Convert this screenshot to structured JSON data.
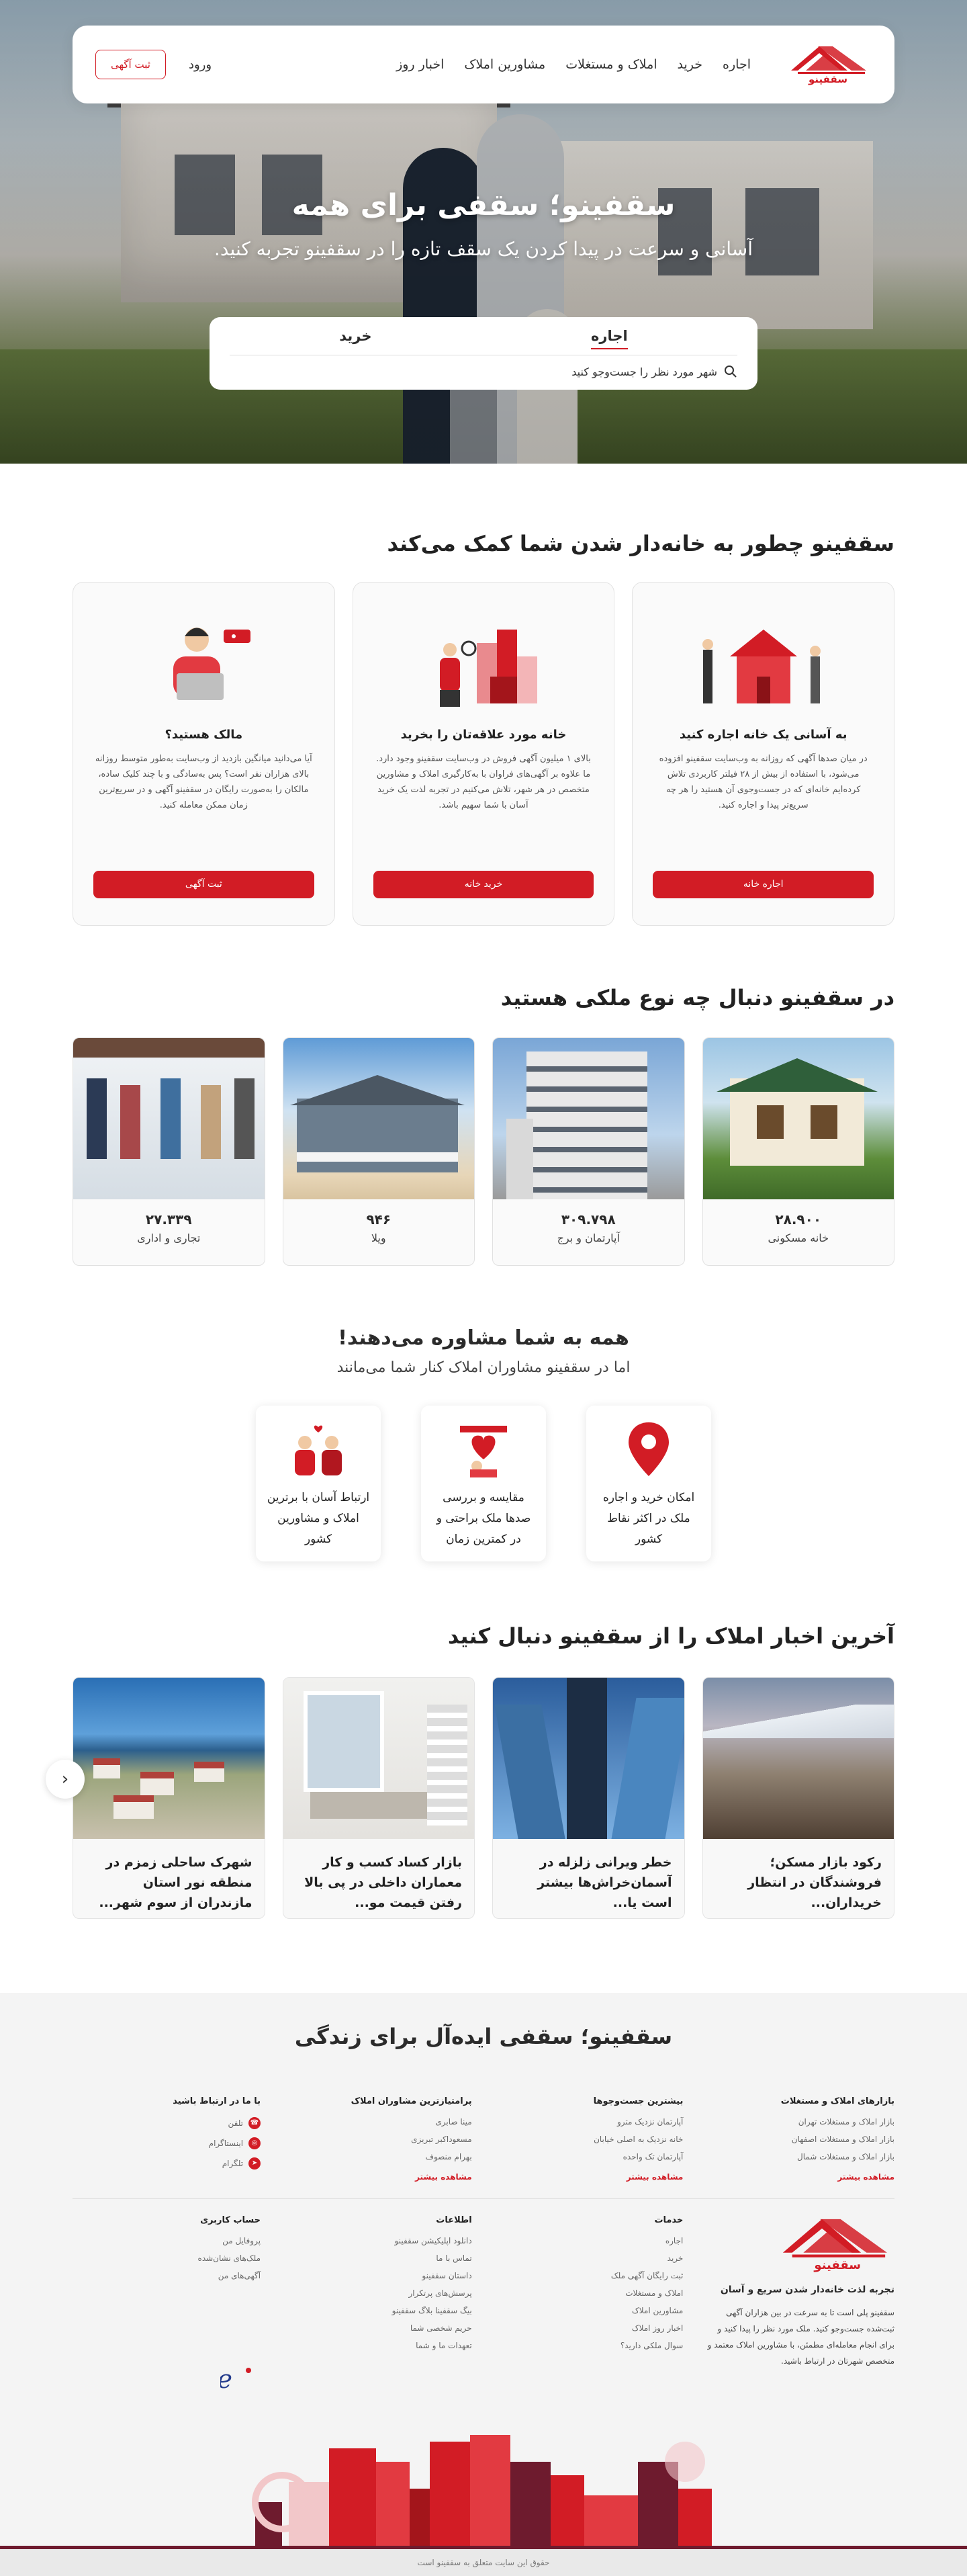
{
  "brand": {
    "name": "سقفینو",
    "accent": "#d21c25"
  },
  "nav": {
    "links": [
      "اجاره",
      "خرید",
      "املاک و مستغلات",
      "مشاورین املاک",
      "اخبار روز"
    ],
    "login": "ورود",
    "post_ad": "ثبت آگهی"
  },
  "hero": {
    "title": "سقفینو؛ سقفی برای همه",
    "subtitle": "آسانی و سرعت در پیدا کردن یک سقف تازه را در سقفینو تجربه کنید.",
    "tabs": [
      "اجاره",
      "خرید"
    ],
    "search_placeholder": "شهر مورد نظر را جست‌وجو کنید"
  },
  "help": {
    "title": "سقفینو چطور به خانه‌دار شدن شما کمک می‌کند",
    "cards": [
      {
        "title": "به آسانی یک خانه اجاره کنید",
        "text": "در میان صدها آگهی که روزانه به وب‌سایت سقفینو افزوده می‌شود، با استفاده از بیش از ۲۸ فیلتر کاربردی تلاش کرده‌ایم خانه‌ای که در جست‌وجوی آن هستید را هر چه سریع‌تر پیدا و اجاره کنید.",
        "button": "اجاره خانه"
      },
      {
        "title": "خانه مورد علاقه‌تان را بخرید",
        "text": "بالای ۱ میلیون آگهی فروش در وب‌سایت سقفینو وجود دارد. ما علاوه بر آگهی‌های فراوان با به‌کارگیری املاک و مشاورین متخصص در هر شهر، تلاش می‌کنیم در تجربه لذت یک خرید آسان با شما سهیم باشد.",
        "button": "خرید خانه"
      },
      {
        "title": "مالک هستید؟",
        "text": "آیا می‌دانید میانگین بازدید از وب‌سایت به‌طور متوسط روزانه بالای هزاران نفر است؟ پس به‌سادگی و با چند کلیک ساده، مالکان را به‌صورت رایگان در سقفینو آگهی و در سریع‌ترین زمان ممکن معامله کنید.",
        "button": "ثبت آگهی"
      }
    ]
  },
  "types": {
    "title": "در سقفینو دنبال چه نوع ملکی هستید",
    "cards": [
      {
        "count": "۲۸.۹۰۰",
        "label": "خانه مسکونی"
      },
      {
        "count": "۳۰۹.۷۹۸",
        "label": "آپارتمان و برج"
      },
      {
        "count": "۹۴۶",
        "label": "ویلا"
      },
      {
        "count": "۲۷.۳۳۹",
        "label": "تجاری و اداری"
      }
    ]
  },
  "advice": {
    "title": "همه به شما مشاوره می‌دهند!",
    "subtitle": "اما در سقفینو مشاوران املاک کنار شما می‌مانند",
    "cards": [
      "امکان خرید و اجاره ملک در اکثر نقاط کشور",
      "مقایسه و بررسی صدها ملک براحتی و در کمترین زمان",
      "ارتباط آسان با برترین املاک و مشاورین کشور"
    ]
  },
  "news": {
    "title": "آخرین اخبار املاک را از سقفینو دنبال کنید",
    "items": [
      "رکود بازار مسکن؛ فروشندگان در انتظار خریداران...",
      "خطر ویرانی زلزله در آسمان‌خراش‌ها بیشتر است یا...",
      "بازار کساد کسب و کار معماران داخلی در پی بالا رفتن قیمت مو...",
      "شهرک ساحلی زمزم در منطقه نور استان مازندران از سوم شهر..."
    ],
    "prev": "‹"
  },
  "footer": {
    "title": "سقفینو؛ سقفی ایده‌آل برای زندگی",
    "cols": [
      {
        "title": "بازارهای املاک و مستغلات",
        "items": [
          "بازار املاک و مستغلات تهران",
          "بازار املاک و مستغلات اصفهان",
          "بازار املاک و مستغلات شمال"
        ],
        "more": "مشاهده بیشتر"
      },
      {
        "title": "بیشترین جست‌وجوها",
        "items": [
          "آپارتمان نزدیک مترو",
          "خانه نزدیک به اصلی خیابان",
          "آپارتمان تک واحده"
        ],
        "more": "مشاهده بیشتر"
      },
      {
        "title": "پرامتیازترین مشاوران املاک",
        "items": [
          "مینا صابری",
          "مسعوداکبر تبریزی",
          "بهرام منصوف"
        ],
        "more": "مشاهده بیشتر"
      },
      {
        "title": "با ما در ارتباط باشید",
        "items": [
          "تلفن",
          "اینستاگرام",
          "تلگرام"
        ]
      }
    ],
    "about": {
      "tagline": "تجربه لذت خانه‌دار شدن سریع و آسان",
      "text": "سقفینو پلی است تا به سرعت در بین هزاران آگهی ثبت‌شده جست‌وجو کنید. ملک مورد نظر را پیدا کنید و برای انجام معامله‌ای مطمئن، با مشاورین املاک معتمد و متخصص شهرتان در ارتباط باشید."
    },
    "lower_cols": [
      {
        "title": "خدمات",
        "items": [
          "اجاره",
          "خرید",
          "ثبت رایگان آگهی ملک",
          "املاک و مستغلات",
          "مشاورین املاک",
          "اخبار روز املاک",
          "سوال ملکی دارید؟"
        ]
      },
      {
        "title": "اطلاعات",
        "items": [
          "دانلود اپلیکیشن سقفینو",
          "تماس با ما",
          "داستان سقفینو",
          "پرسش‌های پرتکرار",
          "بیگ سقفینا بلاگ سقفینو",
          "حریم شخصی شما",
          "تعهدات ما و شما"
        ]
      },
      {
        "title": "حساب کاربری",
        "items": [
          "پروفایل من",
          "ملک‌های نشان‌شده",
          "آگهی‌های من"
        ]
      }
    ],
    "copyright": "حقوق این سایت متعلق به سقفینو است"
  }
}
